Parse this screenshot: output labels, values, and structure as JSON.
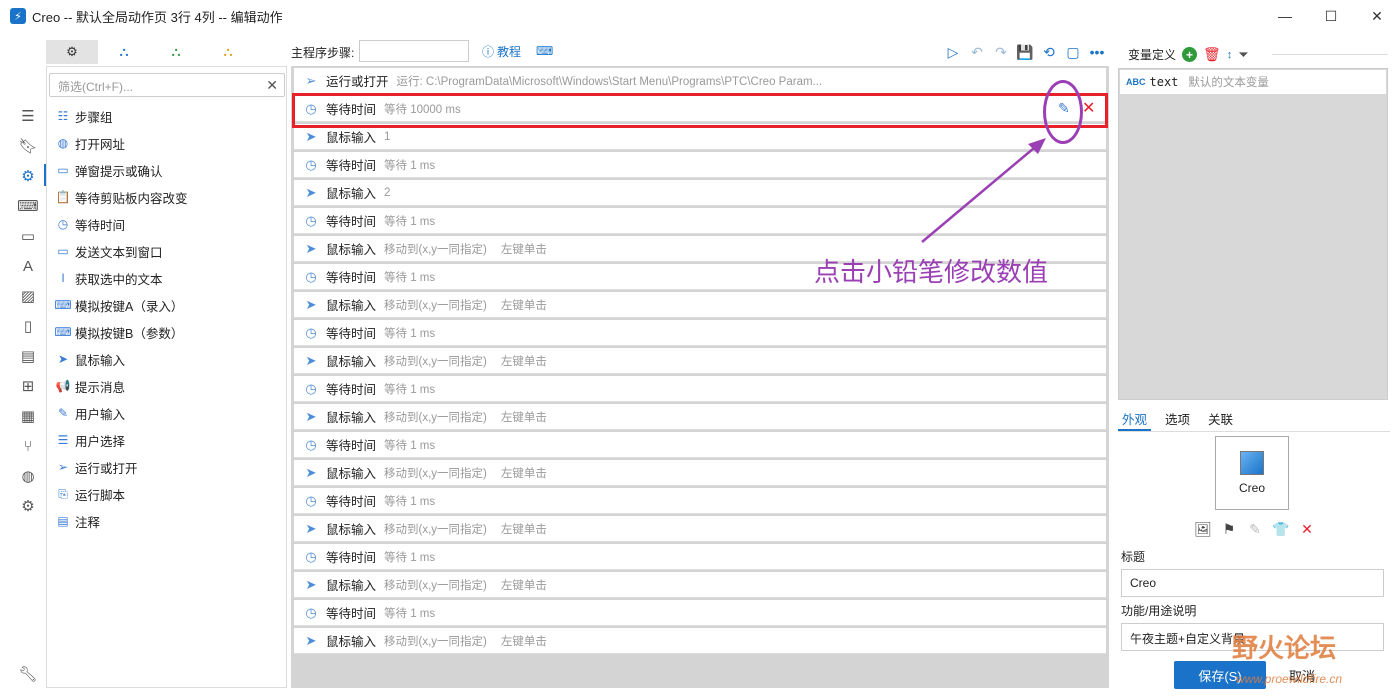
{
  "window": {
    "title": "Creo -- 默认全局动作页 3行 4列 -- 编辑动作",
    "minimize": "—",
    "maximize": "☐",
    "close": "✕"
  },
  "tool_tabs": [
    "⚙",
    "⛬",
    "⛬",
    "⛬"
  ],
  "filter": {
    "placeholder": "筛选(Ctrl+F)...",
    "clear": "✕"
  },
  "tools": [
    {
      "icon": "steps-icon",
      "glyph": "☷",
      "label": "步骤组"
    },
    {
      "icon": "globe-icon",
      "glyph": "◍",
      "label": "打开网址"
    },
    {
      "icon": "dialog-icon",
      "glyph": "▭",
      "label": "弹窗提示或确认"
    },
    {
      "icon": "clipboard-icon",
      "glyph": "📋",
      "label": "等待剪贴板内容改变"
    },
    {
      "icon": "timer-icon",
      "glyph": "◷",
      "label": "等待时间"
    },
    {
      "icon": "message-icon",
      "glyph": "▭",
      "label": "发送文本到窗口"
    },
    {
      "icon": "text-cursor-icon",
      "glyph": "I",
      "label": "获取选中的文本"
    },
    {
      "icon": "keyboard-icon",
      "glyph": "⌨",
      "label": "模拟按键A（录入）"
    },
    {
      "icon": "keyboard-icon",
      "glyph": "⌨",
      "label": "模拟按键B（参数）"
    },
    {
      "icon": "cursor-icon",
      "glyph": "➤",
      "label": "鼠标输入"
    },
    {
      "icon": "megaphone-icon",
      "glyph": "📢",
      "label": "提示消息"
    },
    {
      "icon": "user-input-icon",
      "glyph": "✎",
      "label": "用户输入"
    },
    {
      "icon": "list-icon",
      "glyph": "☰",
      "label": "用户选择"
    },
    {
      "icon": "send-icon",
      "glyph": "➢",
      "label": "运行或打开"
    },
    {
      "icon": "script-icon",
      "glyph": "⎘",
      "label": "运行脚本"
    },
    {
      "icon": "note-icon",
      "glyph": "▤",
      "label": "注释"
    }
  ],
  "main": {
    "label": "主程序步骤:",
    "help": "教程",
    "kb": "⌨"
  },
  "toolbar": [
    "▷",
    "↶",
    "↷",
    "💾",
    "⟲",
    "▢",
    "•••"
  ],
  "steps": [
    {
      "type": "run",
      "icon": "send-icon",
      "glyph": "➢",
      "name": "运行或打开",
      "detail": "运行: C:\\ProgramData\\Microsoft\\Windows\\Start Menu\\Programs\\PTC\\Creo Param...",
      "detail2": ""
    },
    {
      "type": "wait",
      "icon": "timer-icon",
      "glyph": "◷",
      "name": "等待时间",
      "detail": "等待 10000 ms",
      "detail2": ""
    },
    {
      "type": "mouse",
      "icon": "cursor-icon",
      "glyph": "➤",
      "name": "鼠标输入",
      "detail": "1",
      "detail2": ""
    },
    {
      "type": "wait",
      "icon": "timer-icon",
      "glyph": "◷",
      "name": "等待时间",
      "detail": "等待 1 ms",
      "detail2": ""
    },
    {
      "type": "mouse",
      "icon": "cursor-icon",
      "glyph": "➤",
      "name": "鼠标输入",
      "detail": "2",
      "detail2": ""
    },
    {
      "type": "wait",
      "icon": "timer-icon",
      "glyph": "◷",
      "name": "等待时间",
      "detail": "等待 1 ms",
      "detail2": ""
    },
    {
      "type": "mouse",
      "icon": "cursor-icon",
      "glyph": "➤",
      "name": "鼠标输入",
      "detail": "移动到(x,y一同指定)",
      "detail2": "左键单击"
    },
    {
      "type": "wait",
      "icon": "timer-icon",
      "glyph": "◷",
      "name": "等待时间",
      "detail": "等待 1 ms",
      "detail2": ""
    },
    {
      "type": "mouse",
      "icon": "cursor-icon",
      "glyph": "➤",
      "name": "鼠标输入",
      "detail": "移动到(x,y一同指定)",
      "detail2": "左键单击"
    },
    {
      "type": "wait",
      "icon": "timer-icon",
      "glyph": "◷",
      "name": "等待时间",
      "detail": "等待 1 ms",
      "detail2": ""
    },
    {
      "type": "mouse",
      "icon": "cursor-icon",
      "glyph": "➤",
      "name": "鼠标输入",
      "detail": "移动到(x,y一同指定)",
      "detail2": "左键单击"
    },
    {
      "type": "wait",
      "icon": "timer-icon",
      "glyph": "◷",
      "name": "等待时间",
      "detail": "等待 1 ms",
      "detail2": ""
    },
    {
      "type": "mouse",
      "icon": "cursor-icon",
      "glyph": "➤",
      "name": "鼠标输入",
      "detail": "移动到(x,y一同指定)",
      "detail2": "左键单击"
    },
    {
      "type": "wait",
      "icon": "timer-icon",
      "glyph": "◷",
      "name": "等待时间",
      "detail": "等待 1 ms",
      "detail2": ""
    },
    {
      "type": "mouse",
      "icon": "cursor-icon",
      "glyph": "➤",
      "name": "鼠标输入",
      "detail": "移动到(x,y一同指定)",
      "detail2": "左键单击"
    },
    {
      "type": "wait",
      "icon": "timer-icon",
      "glyph": "◷",
      "name": "等待时间",
      "detail": "等待 1 ms",
      "detail2": ""
    },
    {
      "type": "mouse",
      "icon": "cursor-icon",
      "glyph": "➤",
      "name": "鼠标输入",
      "detail": "移动到(x,y一同指定)",
      "detail2": "左键单击"
    },
    {
      "type": "wait",
      "icon": "timer-icon",
      "glyph": "◷",
      "name": "等待时间",
      "detail": "等待 1 ms",
      "detail2": ""
    },
    {
      "type": "mouse",
      "icon": "cursor-icon",
      "glyph": "➤",
      "name": "鼠标输入",
      "detail": "移动到(x,y一同指定)",
      "detail2": "左键单击"
    },
    {
      "type": "wait",
      "icon": "timer-icon",
      "glyph": "◷",
      "name": "等待时间",
      "detail": "等待 1 ms",
      "detail2": ""
    },
    {
      "type": "mouse",
      "icon": "cursor-icon",
      "glyph": "➤",
      "name": "鼠标输入",
      "detail": "移动到(x,y一同指定)",
      "detail2": "左键单击"
    }
  ],
  "annotation": "点击小铅笔修改数值",
  "variables": {
    "header": "变量定义",
    "rows": [
      {
        "type": "ABC",
        "name": "text",
        "desc": "默认的文本变量"
      }
    ]
  },
  "right_tabs": [
    "外观",
    "选项",
    "关联"
  ],
  "preview": {
    "label": "Creo"
  },
  "preview_tools": [
    "🖼",
    "⚑",
    "✎",
    "👕",
    "✕"
  ],
  "fields": {
    "title_label": "标题",
    "title_value": "Creo",
    "desc_label": "功能/用途说明",
    "desc_value": "午夜主题+自定义背景"
  },
  "buttons": {
    "save": "保存(S)",
    "cancel": "取消"
  },
  "watermark": {
    "text": "野火论坛",
    "url": "www.proewildfire.cn"
  },
  "colors": {
    "accent": "#1a73c9",
    "highlight": "#e8202a",
    "annotation": "#9b3fb5"
  }
}
